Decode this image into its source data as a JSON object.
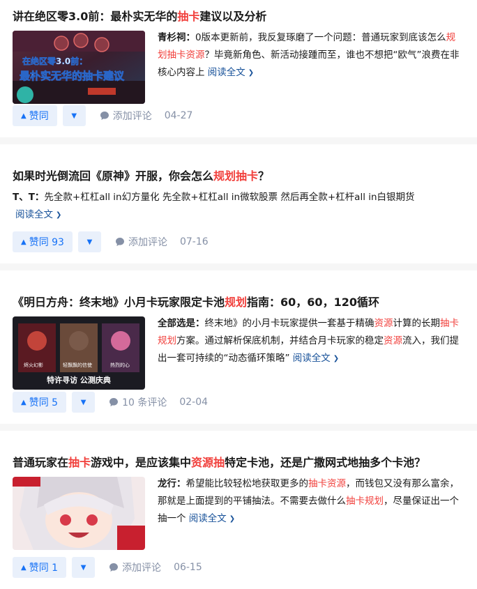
{
  "colors": {
    "highlight": "#f1403c",
    "link": "#175199",
    "vote_bg": "#e9f0fb",
    "vote_fg": "#1772f6",
    "meta": "#8590a6"
  },
  "items": [
    {
      "title_parts": [
        "讲在绝区零3.0前：最朴实无华的",
        "抽卡",
        "建议以及分析"
      ],
      "author": "青杉祠：",
      "excerpt_parts": [
        "0版本更新前，我反复琢磨了一个问题：普通玩家到底该怎么",
        "规划抽卡资源",
        "？毕竟新角色、新活动接踵而至，谁也不想把“欧气”浪费在非核心内容上"
      ],
      "read_more": "阅读全文",
      "vote_label": "赞同",
      "comment_label": "添加评论",
      "date": "04-27",
      "thumb_text": [
        "在绝区零3.0前：",
        "最朴实无华的抽卡建议"
      ]
    },
    {
      "title_parts": [
        "如果时光倒流回《原神》开服，你会怎么",
        "规划抽卡",
        "？"
      ],
      "author": "T、T：",
      "excerpt": "先全款+杠杠all in幻方量化 先全款+杠杠all in微软股票 然后再全款+杠杆all in白银期货",
      "read_more": "阅读全文",
      "vote_label": "赞同 93",
      "comment_label": "添加评论",
      "date": "07-16"
    },
    {
      "title_parts": [
        "《明日方舟：终末地》小月卡玩家限定卡池",
        "规划",
        "指南：60，60，120循环"
      ],
      "author": "全部选是：",
      "excerpt_parts": [
        "终末地》的小月卡玩家提供一套基于精确",
        "资源",
        "计算的长期",
        "抽卡规划",
        "方案。通过解析保底机制，并结合月卡玩家的稳定",
        "资源",
        "流入，我们提出一套可持续的“动态循环策略”"
      ],
      "read_more": "阅读全文",
      "vote_label": "赞同 5",
      "comment_label": "10 条评论",
      "date": "02-04",
      "thumb_text": [
        "特许寻访 公测庆典",
        "轻飘飘的信使",
        "烬火幻影",
        "热烈的心"
      ]
    },
    {
      "title_parts": [
        "普通玩家在",
        "抽卡",
        "游戏中，是应该集中",
        "资源抽",
        "特定卡池，还是广撒网式地抽多个卡池？"
      ],
      "author": "龙行：",
      "excerpt_parts": [
        "希望能比较轻松地获取更多的",
        "抽卡资源",
        "，而钱包又没有那么富余，那就是上面提到的平铺抽法。不需要去做什么",
        "抽卡规划",
        "，尽量保证出一个抽一个"
      ],
      "read_more": "阅读全文",
      "vote_label": "赞同 1",
      "comment_label": "添加评论",
      "date": "06-15"
    }
  ]
}
